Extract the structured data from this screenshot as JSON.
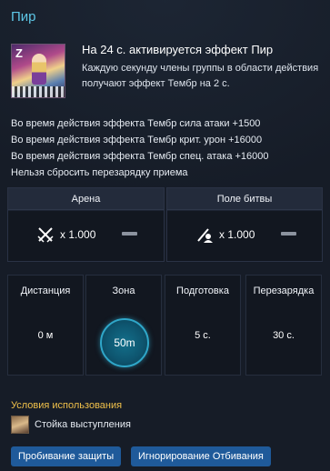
{
  "skill": {
    "name": "Пир",
    "headline": "На 24 с. активируется эффект Пир",
    "description": "Каждую секунду члены группы в области действия получают эффект Тембр на 2 с.",
    "icon_glyph": "Z"
  },
  "effects": [
    "Во время действия эффекта Тембр сила атаки +1500",
    "Во время действия эффекта Тембр крит. урон +16000",
    "Во время действия эффекта Тембр спец. атака +16000",
    "Нельзя сбросить перезарядку приема"
  ],
  "pvx": {
    "arena": {
      "label": "Арена",
      "value": "x 1.000",
      "icon": "crossed-swords-icon"
    },
    "battlefield": {
      "label": "Поле битвы",
      "value": "x 1.000",
      "icon": "sword-person-icon"
    }
  },
  "stats": {
    "distance": {
      "label": "Дистанция",
      "value": "0 м"
    },
    "zone": {
      "label": "Зона",
      "value": "50m"
    },
    "prep": {
      "label": "Подготовка",
      "value": "5 с."
    },
    "cooldown": {
      "label": "Перезарядка",
      "value": "30 с."
    }
  },
  "conditions": {
    "title": "Условия использования",
    "stance": "Стойка выступления",
    "stance_icon": "performance-stance-icon"
  },
  "tags": [
    "Пробивание защиты",
    "Игнорирование Отбивания"
  ],
  "colors": {
    "title": "#5dc6e6",
    "conditions_title": "#f0c04a",
    "tag_bg": "#1f5a9a",
    "zone_ring": "#2fa7c9"
  }
}
